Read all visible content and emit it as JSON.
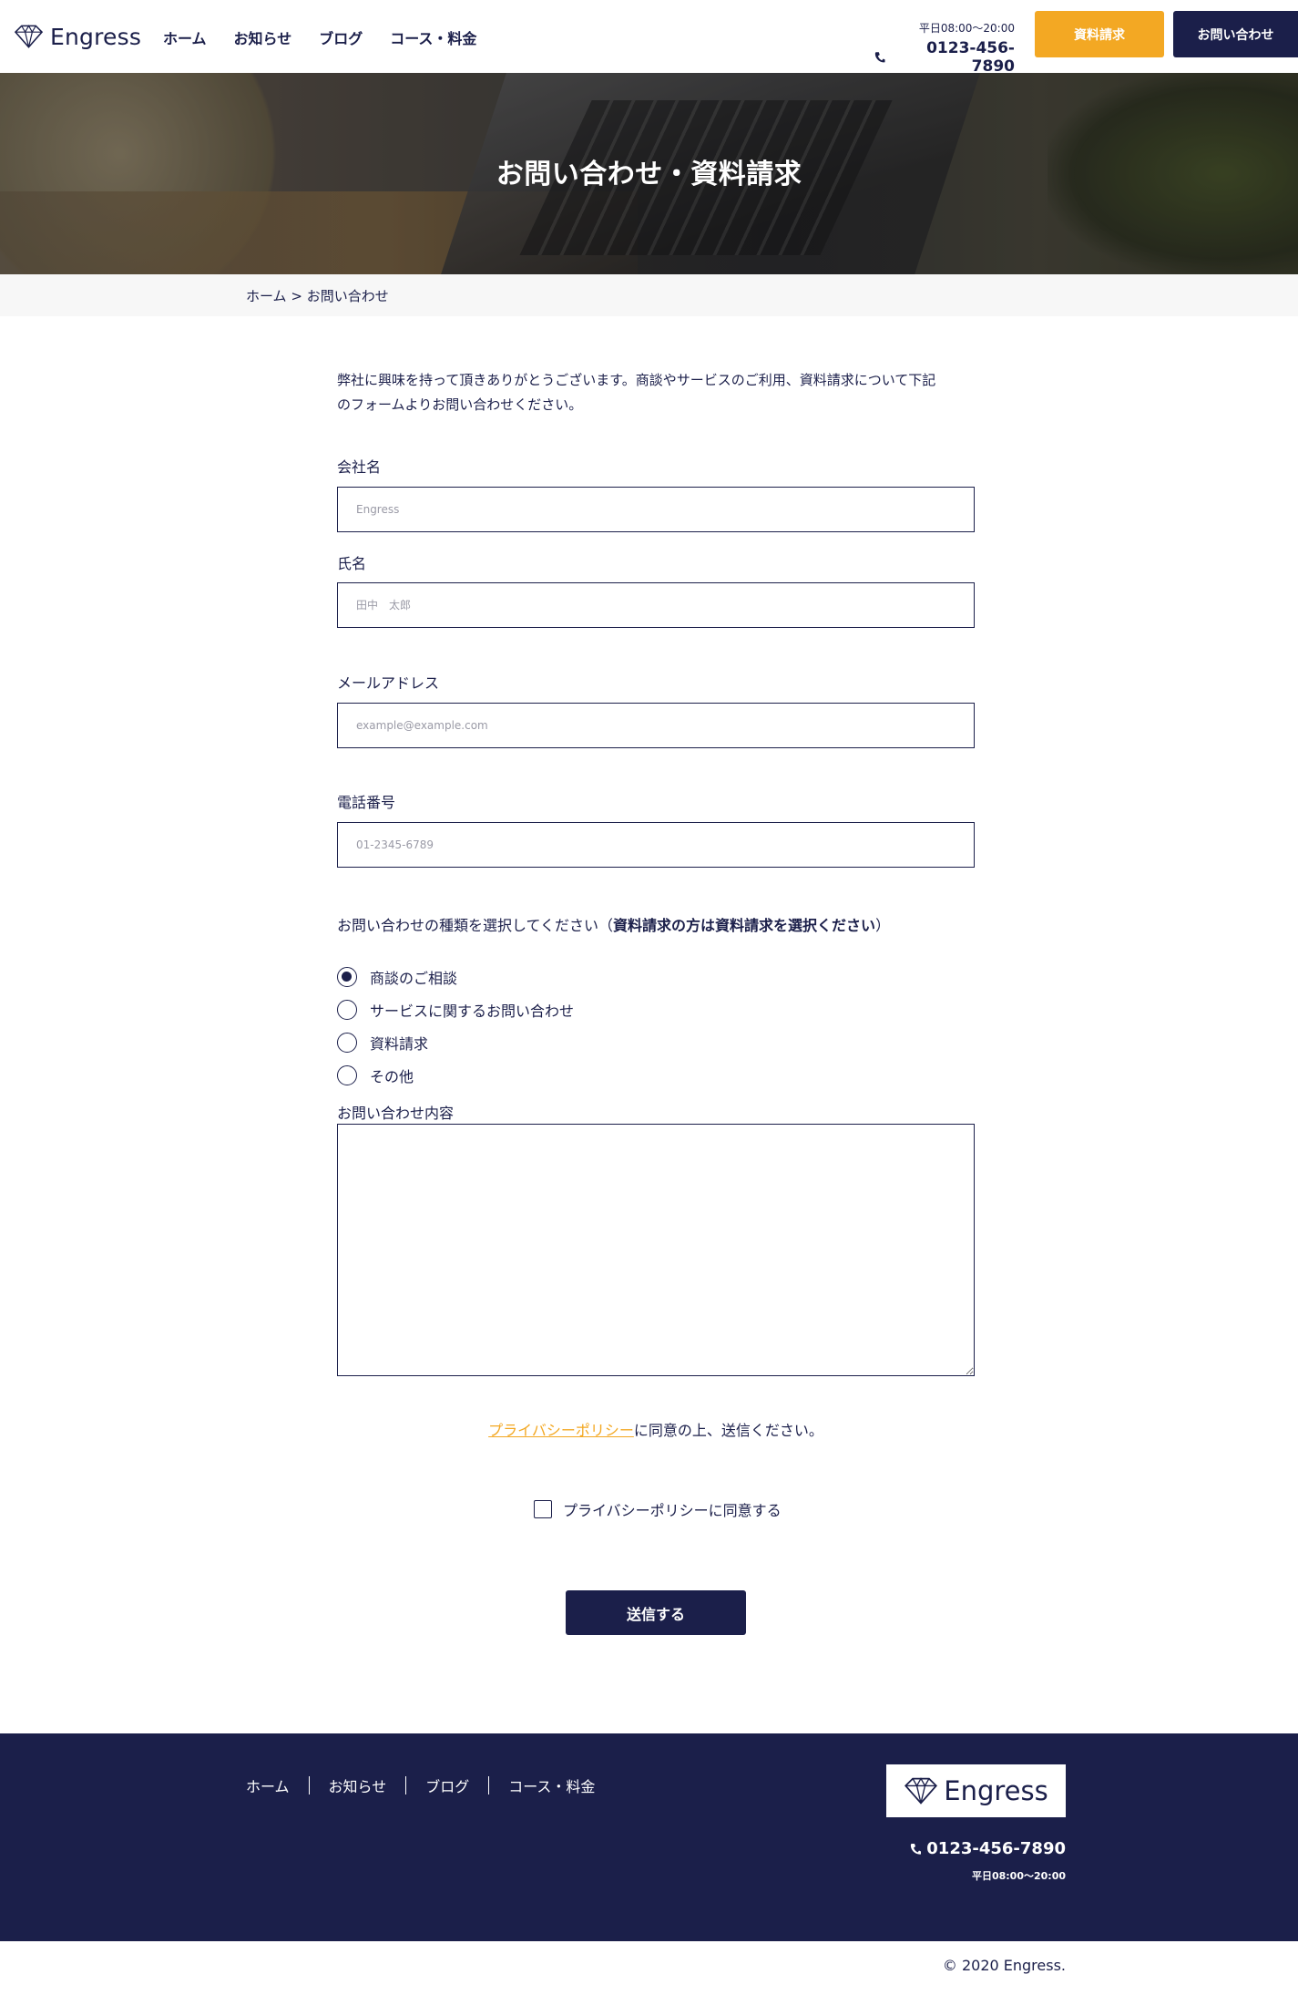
{
  "brand": {
    "name": "Engress",
    "icon": "diamond-icon",
    "colors": {
      "navy": "#1b1f4a",
      "accent": "#f3a823"
    }
  },
  "header": {
    "nav": [
      "ホーム",
      "お知らせ",
      "ブログ",
      "コース・料金"
    ],
    "hours": "平日08:00〜20:00",
    "phone": "0123-456-7890",
    "doc_request_label": "資料請求",
    "contact_label": "お問い合わせ"
  },
  "hero": {
    "title": "お問い合わせ・資料請求"
  },
  "breadcrumb": {
    "home": "ホーム",
    "separator": ">",
    "current": "お問い合わせ"
  },
  "form": {
    "intro_line1": "弊社に興味を持って頂きありがとうございます。商談やサービスのご利用、資料請求について下記",
    "intro_line2": "のフォームよりお問い合わせください。",
    "company_label": "会社名",
    "company_placeholder": "Engress",
    "name_label": "氏名",
    "name_placeholder": "田中　太郎",
    "email_label": "メールアドレス",
    "email_placeholder": "example@example.com",
    "phone_label": "電話番号",
    "phone_placeholder": "01-2345-6789",
    "type_prompt": "お問い合わせの種類を選択してください（",
    "type_prompt_bold": "資料請求の方は資料請求を選択ください",
    "type_prompt_end": "）",
    "types": [
      "商談のご相談",
      "サービスに関するお問い合わせ",
      "資料請求",
      "その他"
    ],
    "selected_type": "商談のご相談",
    "message_label": "お問い合わせ内容",
    "policy_link": "プライバシーポリシー",
    "policy_note": "に同意の上、送信ください。",
    "agree_label": "プライバシーポリシーに同意する",
    "submit_label": "送信する"
  },
  "footer": {
    "nav": [
      "ホーム",
      "お知らせ",
      "ブログ",
      "コース・料金"
    ],
    "phone": "0123-456-7890",
    "hours": "平日08:00〜20:00",
    "copyright": "© 2020 Engress."
  }
}
